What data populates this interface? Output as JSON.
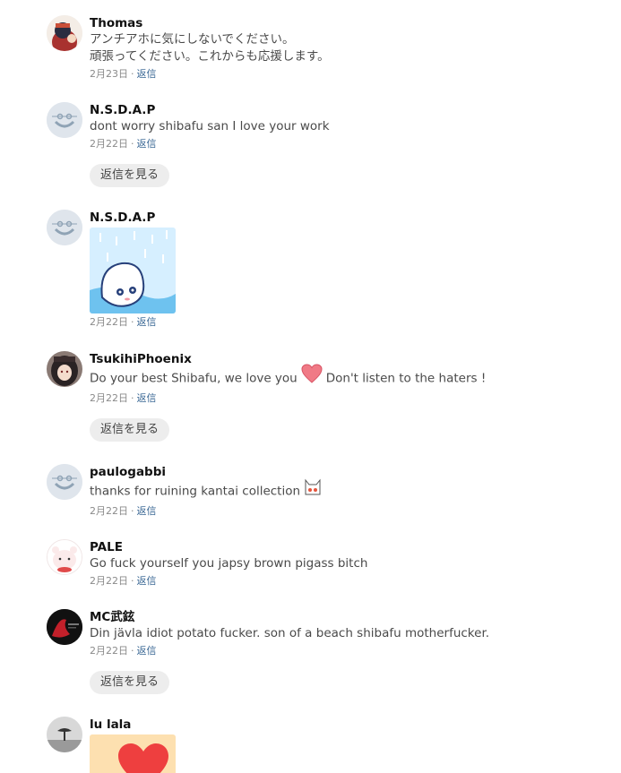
{
  "comments": [
    {
      "author": "Thomas",
      "line1": "アンチアホに気にしないでください。",
      "line2": "頑張ってください。これからも応援します。",
      "date": "2月23日",
      "reply_label": "返信"
    },
    {
      "author": "N.S.D.A.P",
      "text": "dont worry shibafu san I love your work",
      "date": "2月22日",
      "reply_label": "返信",
      "view_replies_label": "返信を見る"
    },
    {
      "author": "N.S.D.A.P",
      "date": "2月22日",
      "reply_label": "返信"
    },
    {
      "author": "TsukihiPhoenix",
      "text_before": "Do your best Shibafu, we love you",
      "emoji": "heart",
      "text_after": "Don't listen to the haters !",
      "date": "2月22日",
      "reply_label": "返信",
      "view_replies_label": "返信を見る"
    },
    {
      "author": "paulogabbi",
      "text": "thanks for ruining kantai collection",
      "emoji": "cat-face",
      "date": "2月22日",
      "reply_label": "返信"
    },
    {
      "author": "PALE",
      "text": "Go fuck yourself you japsy brown pigass bitch",
      "date": "2月22日",
      "reply_label": "返信"
    },
    {
      "author": "MC武鉉",
      "text": "Din jävla idiot potato fucker. son of a beach shibafu motherfucker.",
      "date": "2月22日",
      "reply_label": "返信",
      "view_replies_label": "返信を見る"
    },
    {
      "author": "lu lala"
    }
  ],
  "meta_separator": "·",
  "colors": {
    "reply_link": "#3d6a96",
    "view_replies_bg": "#ededed",
    "default_avatar_bg": "#dfe5ec",
    "heart": "#f07a86"
  }
}
